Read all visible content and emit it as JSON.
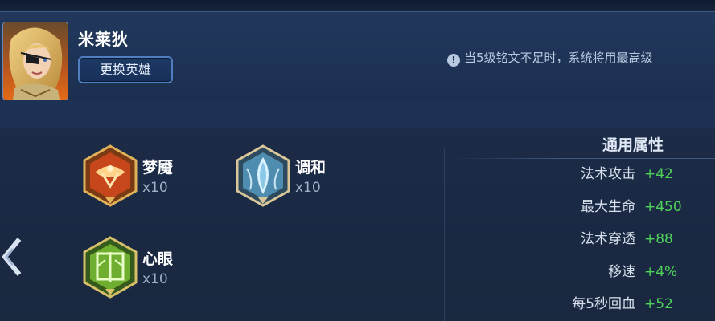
{
  "hero": {
    "name": "米莱狄",
    "change_button_label": "更换英雄"
  },
  "notice": {
    "icon": "exclamation-icon",
    "icon_glyph": "!",
    "text": "当5级铭文不足时，系统将用最高级"
  },
  "runes": [
    {
      "name": "梦魇",
      "count": "x10",
      "color": "red",
      "icon": "nightmare-rune-icon"
    },
    {
      "name": "调和",
      "count": "x10",
      "color": "blue",
      "icon": "harmony-rune-icon"
    },
    {
      "name": "心眼",
      "count": "x10",
      "color": "green",
      "icon": "mind-eye-rune-icon"
    }
  ],
  "attributes": {
    "title": "通用属性",
    "rows": [
      {
        "label": "法术攻击",
        "value": "+42"
      },
      {
        "label": "最大生命",
        "value": "+450"
      },
      {
        "label": "法术穿透",
        "value": "+88"
      },
      {
        "label": "移速",
        "value": "+4%"
      },
      {
        "label": "每5秒回血",
        "value": "+52"
      }
    ]
  },
  "colors": {
    "background": "#1b2a45",
    "header": "#1e3356",
    "accent_blue": "#4f7fbf",
    "value_green": "#4fd25a"
  }
}
